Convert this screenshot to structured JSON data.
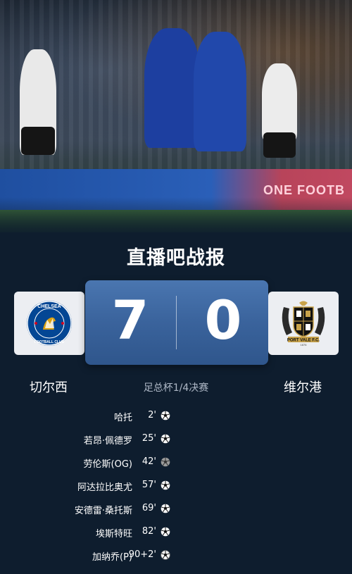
{
  "hero": {
    "board_text": "ONE FOOTB"
  },
  "title": "直播吧战报",
  "match": {
    "home": {
      "name": "切尔西",
      "logo_text_top": "CHELSEA",
      "logo_text_bottom": "FOOTBALL CLUB",
      "score": "7"
    },
    "away": {
      "name": "维尔港",
      "logo_text": "PORT VALE F.C.",
      "logo_year": "1876",
      "score": "0"
    },
    "competition": "足总杯1/4决赛"
  },
  "goals": [
    {
      "scorer": "哈托",
      "minute": "2'",
      "icon": "soccer-ball-icon"
    },
    {
      "scorer": "若昂·佩德罗",
      "minute": "25'",
      "icon": "soccer-ball-icon"
    },
    {
      "scorer": "劳伦斯(OG)",
      "minute": "42'",
      "icon": "own-goal-ball-icon"
    },
    {
      "scorer": "阿达拉比奥尤",
      "minute": "57'",
      "icon": "soccer-ball-icon"
    },
    {
      "scorer": "安德雷·桑托斯",
      "minute": "69'",
      "icon": "soccer-ball-icon"
    },
    {
      "scorer": "埃斯特旺",
      "minute": "82'",
      "icon": "soccer-ball-icon"
    },
    {
      "scorer": "加纳乔(P)",
      "minute": "90+2'",
      "icon": "penalty-ball-icon"
    }
  ],
  "colors": {
    "background": "#0e1d2e",
    "score_box": "#3a639c",
    "chelsea_blue": "#034694",
    "port_vale_gold": "#c8a24a"
  }
}
